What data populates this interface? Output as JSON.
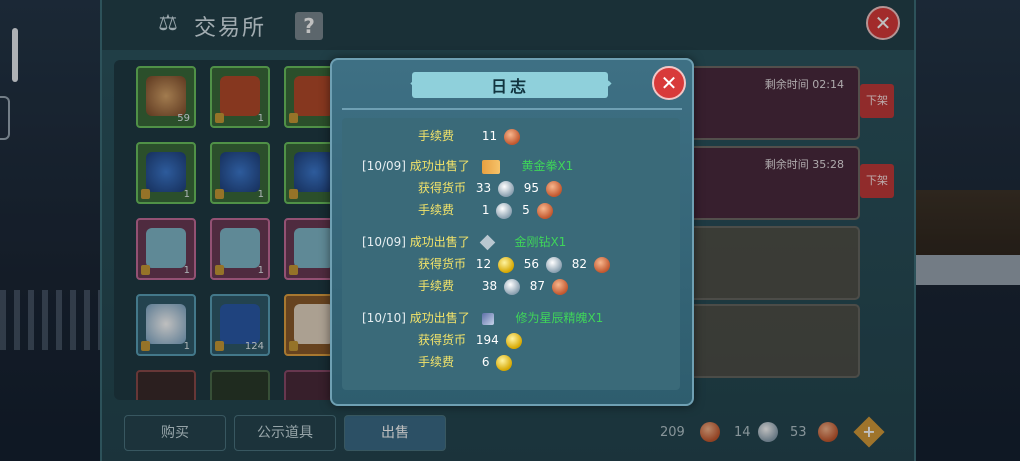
{
  "window": {
    "title": "交易所"
  },
  "icons": {
    "scale": "scale-icon",
    "help": "help-icon",
    "close": "close-icon"
  },
  "help_label": "?",
  "close_label": "✕",
  "listings": [
    {
      "time": "剩余时间 02:14",
      "remove_label": "下架"
    },
    {
      "time": "剩余时间 35:28",
      "remove_label": "下架"
    }
  ],
  "bottom_tabs": [
    {
      "label": "购买"
    },
    {
      "label": "公示道具"
    },
    {
      "label": "出售"
    }
  ],
  "currency": {
    "copper": "209",
    "silver": "14",
    "bronze": "53"
  },
  "slots": [
    {
      "count": "59"
    },
    {
      "count": "1"
    },
    {
      "count": "1"
    },
    {
      "count": "1"
    },
    {
      "count": "1"
    },
    {
      "count": "1"
    },
    {
      "count": "1"
    },
    {
      "count": "1"
    },
    {
      "count": "1"
    },
    {
      "count": "1"
    },
    {
      "count": "124"
    }
  ],
  "log": {
    "title": "日志",
    "fee_label": "手续费",
    "gain_label": "获得货币",
    "sold_label": "成功出售了",
    "entry0": {
      "fee": "11"
    },
    "entry1": {
      "date": "[10/09]",
      "item_name": "黄金拳X1",
      "gain": [
        "33",
        "95"
      ],
      "fee": [
        "1",
        "5"
      ]
    },
    "entry2": {
      "date": "[10/09]",
      "item_name": "金刚钻X1",
      "gain": [
        "12",
        "56",
        "82"
      ],
      "fee": [
        "38",
        "87"
      ]
    },
    "entry3": {
      "date": "[10/10]",
      "item_name": "修为星辰精魄X1",
      "gain": [
        "194"
      ],
      "fee": [
        "6"
      ]
    }
  },
  "colors": {
    "accent": "#8fd0db",
    "close": "#d83a3a",
    "item_name": "#3fd45a",
    "label": "#f2e36a"
  }
}
